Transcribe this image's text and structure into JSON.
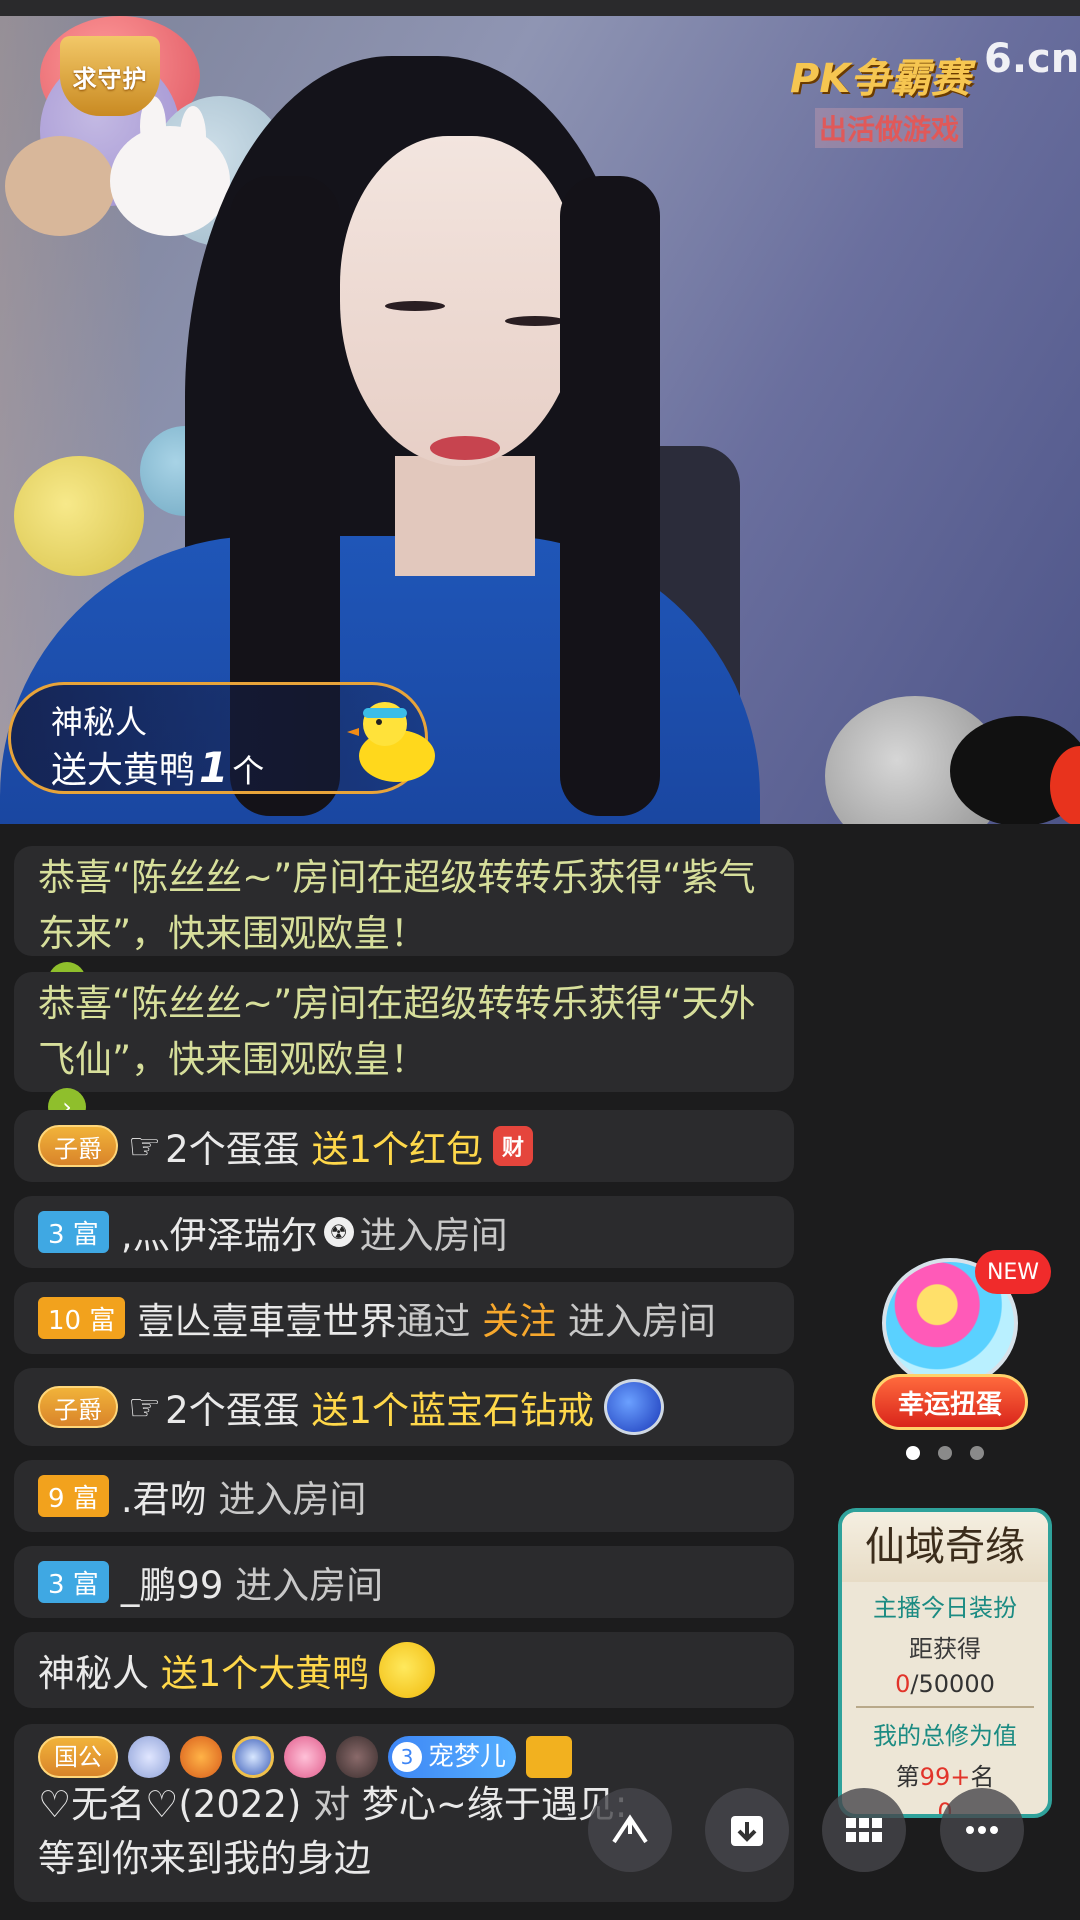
{
  "video": {
    "guard_badge": "求守护",
    "brand_pk": "PK争霸赛",
    "brand_sub": "出活做游戏",
    "brand_site": "6.cn",
    "gift_banner": {
      "sender": "神秘人",
      "action": "送大黄鸭",
      "count": "1",
      "unit": "个"
    }
  },
  "chat": {
    "sys1": {
      "text": "恭喜“陈丝丝~”房间在超级转转乐获得“紫气东来”，快来围观欧皇！"
    },
    "sys2": {
      "text": "恭喜“陈丝丝~”房间在超级转转乐获得“天外飞仙”，快来围观欧皇！"
    },
    "m3": {
      "badge": "子爵",
      "hand": "☞",
      "user": "2个蛋蛋",
      "action": "送1个红包",
      "icon_text": "财"
    },
    "m4": {
      "level": "3 富",
      "user": ",灬伊泽瑞尔",
      "symbol": "☢",
      "action": "进入房间"
    },
    "m5": {
      "level": "10 富",
      "user": "壹亾壹車壹世界",
      "via": "通过",
      "method": "关注",
      "action": "进入房间"
    },
    "m6": {
      "badge": "子爵",
      "hand": "☞",
      "user": "2个蛋蛋",
      "action": "送1个蓝宝石钻戒"
    },
    "m7": {
      "level": "9 富",
      "user": ".君吻",
      "action": "进入房间"
    },
    "m8": {
      "level": "3 富",
      "user": "_鹏99",
      "action": "进入房间"
    },
    "m9": {
      "user": "神秘人",
      "action": "送1个大黄鸭"
    },
    "m10": {
      "title": "国公",
      "fan_num": "3",
      "fan_name": "宠梦儿",
      "user": "♡无名♡(2022)",
      "to": "对",
      "target": "梦心~缘于遇见:",
      "message": "等到你来到我的身边"
    }
  },
  "side": {
    "gacha_new": "NEW",
    "gacha_label": "幸运扭蛋",
    "event_title": "仙域奇缘",
    "event_l1": "主播今日装扮",
    "event_l2": "距获得",
    "event_progress_cur": "0",
    "event_progress_total": "/50000",
    "event_l4": "我的总修为值",
    "event_rank_pre": "第",
    "event_rank": "99+",
    "event_rank_post": "名",
    "event_score": "0"
  },
  "toolbar": {
    "share_icon": "share-icon",
    "download_icon": "download-icon",
    "grid_icon": "grid-icon",
    "more_icon": "more-icon"
  }
}
